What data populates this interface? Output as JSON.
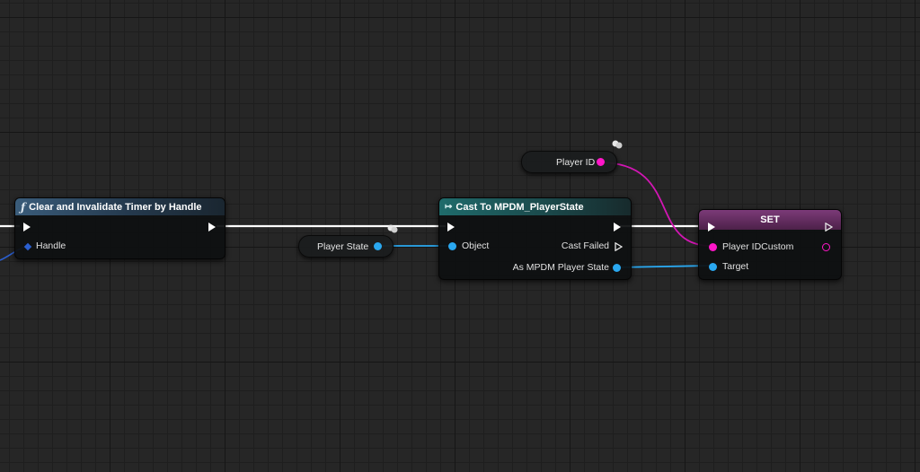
{
  "nodes": {
    "clear_timer": {
      "title": "Clear and Invalidate Timer by Handle",
      "icon": "function-icon",
      "pins": {
        "handle": "Handle"
      }
    },
    "player_state_var": {
      "label": "Player State"
    },
    "cast": {
      "title": "Cast To MPDM_PlayerState",
      "icon": "cast-icon",
      "pins": {
        "object": "Object",
        "cast_failed": "Cast Failed",
        "as_player_state": "As MPDM Player State"
      }
    },
    "player_id_var": {
      "label": "Player ID"
    },
    "set": {
      "title": "SET",
      "pins": {
        "player_id_custom": "Player IDCustom",
        "target": "Target"
      }
    }
  },
  "colors": {
    "exec": "#ffffff",
    "object_pin": "#2aa8f0",
    "string_pin": "#ff16c8",
    "struct_pin": "#2b5fd0",
    "background": "#262626"
  }
}
